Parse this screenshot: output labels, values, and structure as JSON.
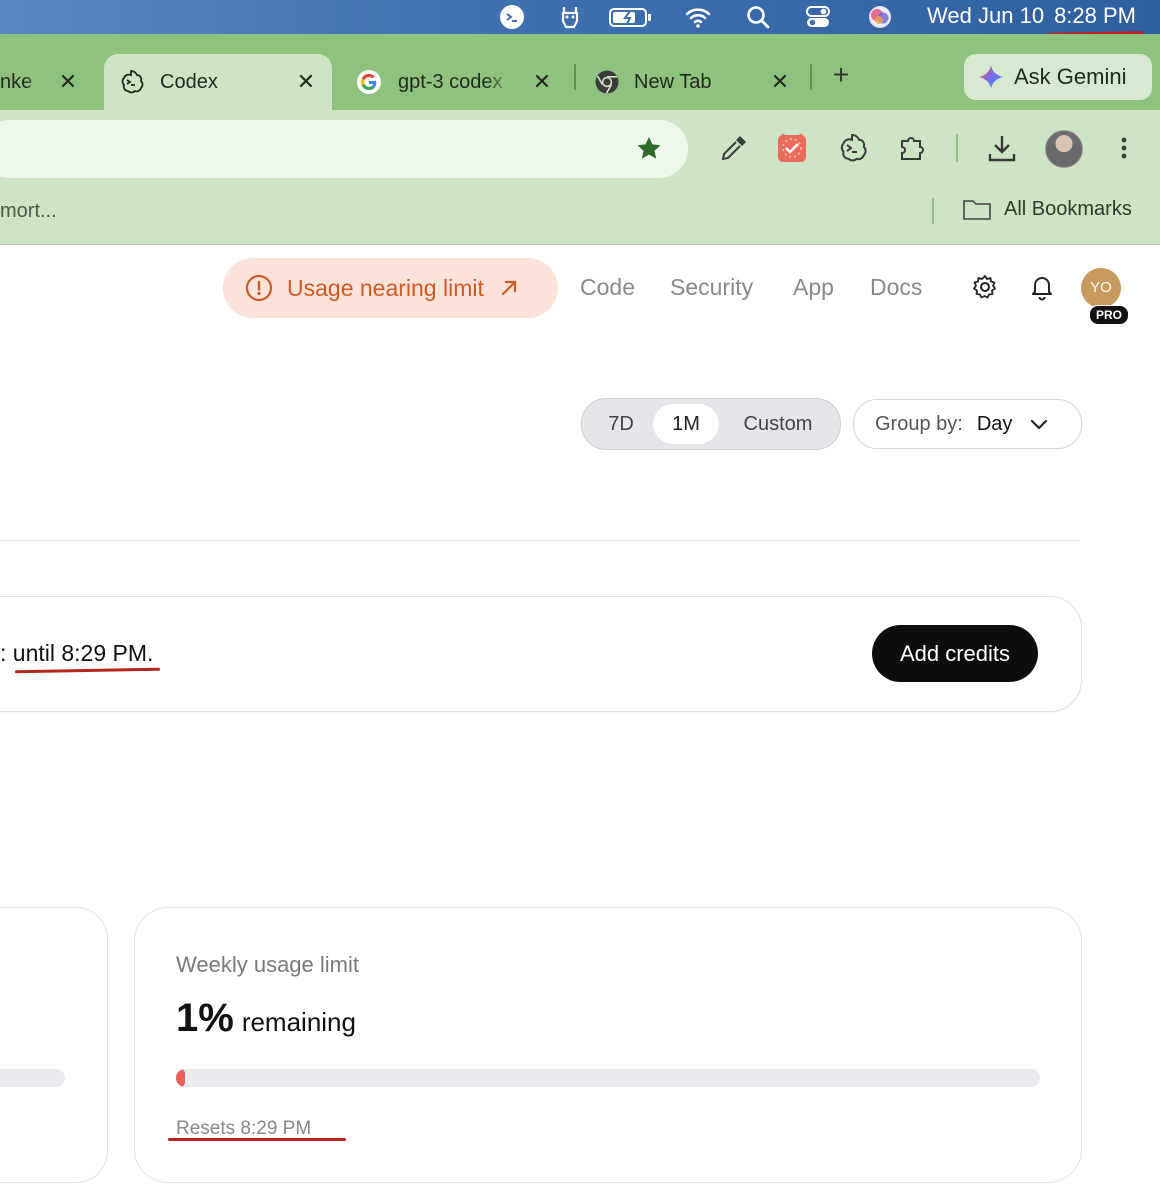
{
  "menubar": {
    "icons": [
      "codex-icon",
      "alpaca-icon",
      "battery-icon",
      "wifi-icon",
      "search-icon",
      "control-center-icon",
      "siri-icon"
    ],
    "date": "Wed Jun 10",
    "time": "8:28 PM"
  },
  "tabs": [
    {
      "title": "nke",
      "active": false
    },
    {
      "title": "Codex",
      "active": true
    },
    {
      "title": "gpt-3 codex",
      "active": false
    },
    {
      "title": "New Tab",
      "active": false
    }
  ],
  "tab_close_glyph": "✕",
  "new_tab_glyph": "+",
  "gemini_label": "Ask Gemini",
  "bookmarks": {
    "left_text": "mort...",
    "all_label": "All Bookmarks"
  },
  "header": {
    "usage_alert": "Usage nearing limit",
    "nav": [
      "Code",
      "Security",
      "App",
      "Docs"
    ],
    "user_initials": "YO",
    "plan_badge": "PRO"
  },
  "range": {
    "options": [
      "7D",
      "1M",
      "Custom"
    ],
    "selected": "1M"
  },
  "group_by": {
    "label": "Group by:",
    "value": "Day"
  },
  "credits": {
    "text_prefix": ": ",
    "text_underlined": "until 8:29 PM.",
    "button": "Add credits"
  },
  "weekly": {
    "title": "Weekly usage limit",
    "percent": "1%",
    "remaining_label": "remaining",
    "used_fraction": 0.01,
    "resets": "Resets 8:29 PM"
  },
  "colors": {
    "accent_orange": "#d15a22",
    "bar_fill": "#e8615e",
    "annotation_red": "#b5261e"
  }
}
